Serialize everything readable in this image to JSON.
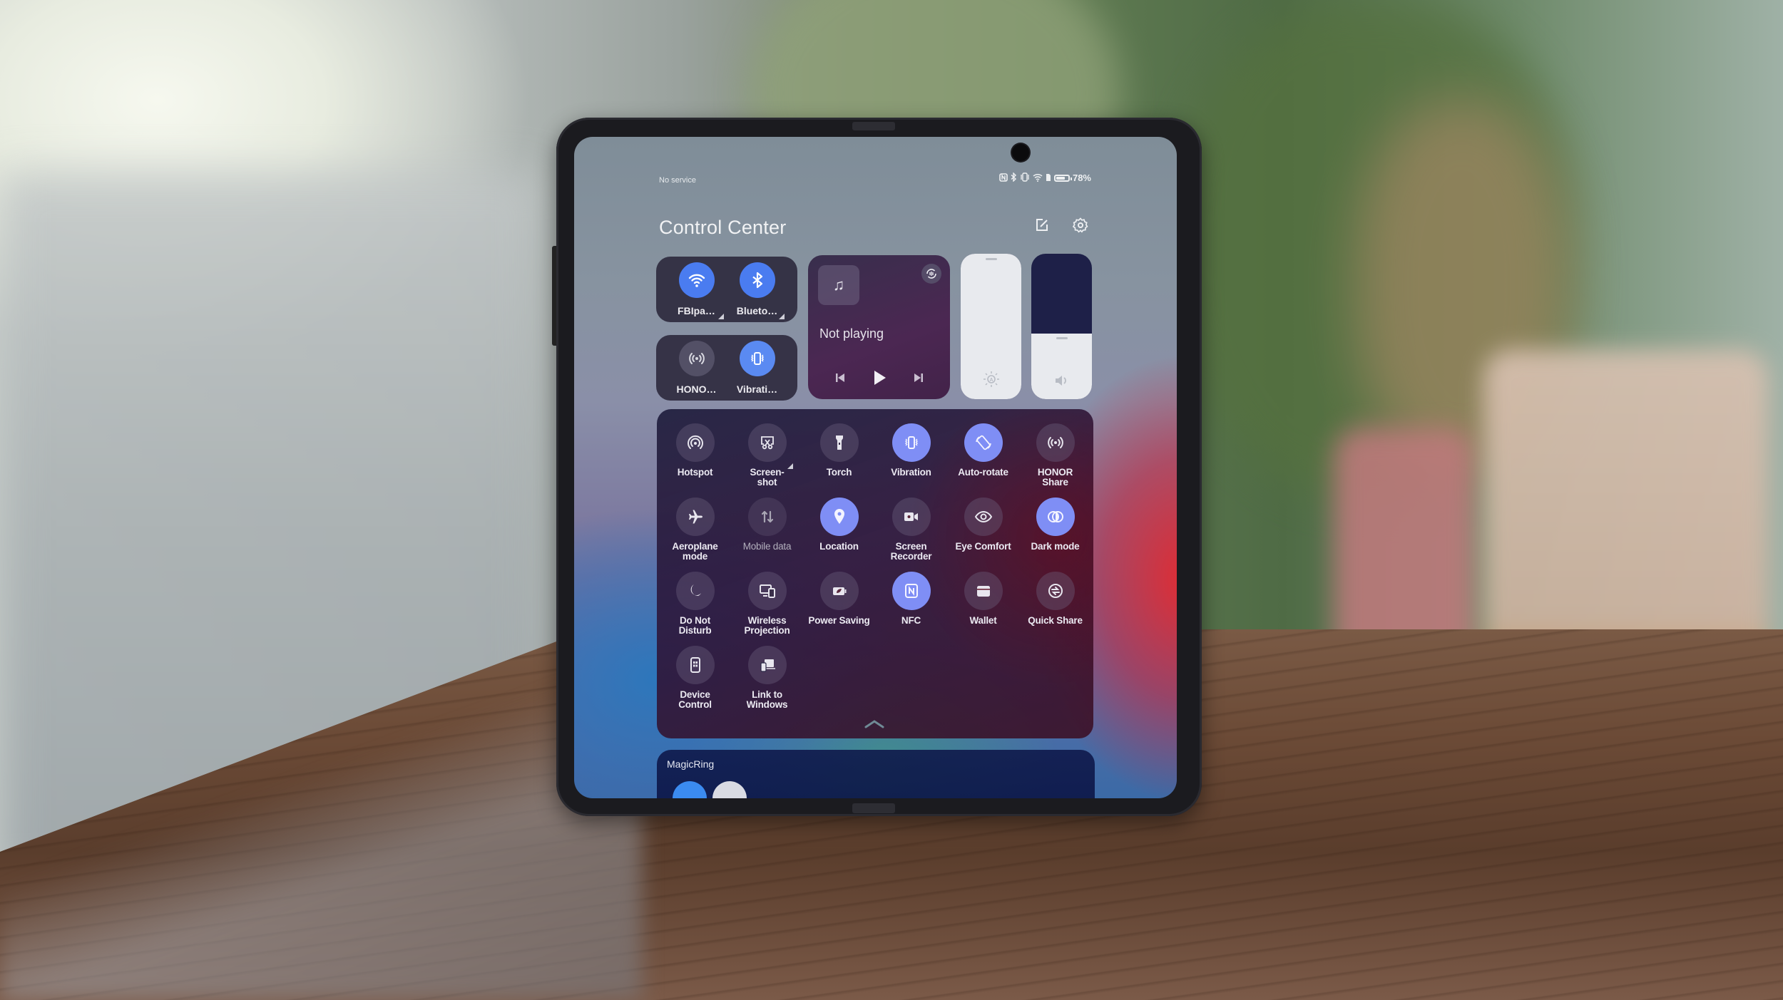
{
  "status_bar": {
    "carrier": "No service",
    "icons": [
      "nfc-icon",
      "bluetooth-icon",
      "vibrate-icon",
      "wifi-icon",
      "sim-icon",
      "battery-icon"
    ],
    "battery_percent": "78%",
    "battery_level": 0.78
  },
  "header": {
    "title": "Control Center",
    "edit_icon": "edit-icon",
    "settings_icon": "gear-icon"
  },
  "connectivity": [
    {
      "label": "FBIpa…",
      "icon": "wifi-icon",
      "on": true,
      "expandable": true
    },
    {
      "label": "Blueto…",
      "icon": "bluetooth-icon",
      "on": true,
      "expandable": true
    },
    {
      "label": "HONO…",
      "icon": "honor-share-icon",
      "on": false,
      "expandable": false
    },
    {
      "label": "Vibrati…",
      "icon": "vibration-icon",
      "on": true,
      "expandable": false
    }
  ],
  "media": {
    "status": "Not playing",
    "art_icon": "♫",
    "controls": [
      "previous",
      "play",
      "next"
    ]
  },
  "sliders": {
    "brightness": {
      "level": 1.0,
      "icon": "auto-brightness-icon"
    },
    "volume": {
      "level": 0.45,
      "icon": "speaker-icon"
    }
  },
  "quick_settings": [
    {
      "label": "Hotspot",
      "icon": "hotspot",
      "state": "off"
    },
    {
      "label": "Screen-\nshot",
      "icon": "screenshot",
      "state": "off",
      "expandable": true
    },
    {
      "label": "Torch",
      "icon": "torch",
      "state": "off"
    },
    {
      "label": "Vibration",
      "icon": "vibration",
      "state": "on"
    },
    {
      "label": "Auto-rotate",
      "icon": "rotate",
      "state": "on"
    },
    {
      "label": "HONOR\nShare",
      "icon": "honor-share",
      "state": "off"
    },
    {
      "label": "Aeroplane\nmode",
      "icon": "airplane",
      "state": "off"
    },
    {
      "label": "Mobile data",
      "icon": "mobile-data",
      "state": "dim"
    },
    {
      "label": "Location",
      "icon": "location",
      "state": "on"
    },
    {
      "label": "Screen\nRecorder",
      "icon": "recorder",
      "state": "off"
    },
    {
      "label": "Eye Comfort",
      "icon": "eye",
      "state": "off"
    },
    {
      "label": "Dark mode",
      "icon": "dark-mode",
      "state": "on"
    },
    {
      "label": "Do Not\nDisturb",
      "icon": "moon",
      "state": "off"
    },
    {
      "label": "Wireless\nProjection",
      "icon": "projection",
      "state": "off"
    },
    {
      "label": "Power Saving",
      "icon": "power-saving",
      "state": "off"
    },
    {
      "label": "NFC",
      "icon": "nfc",
      "state": "on"
    },
    {
      "label": "Wallet",
      "icon": "wallet",
      "state": "off"
    },
    {
      "label": "Quick Share",
      "icon": "quick-share",
      "state": "off"
    },
    {
      "label": "Device\nControl",
      "icon": "device-control",
      "state": "off"
    },
    {
      "label": "Link to\nWindows",
      "icon": "link-windows",
      "state": "off"
    }
  ],
  "magicring": {
    "title": "MagicRing"
  }
}
